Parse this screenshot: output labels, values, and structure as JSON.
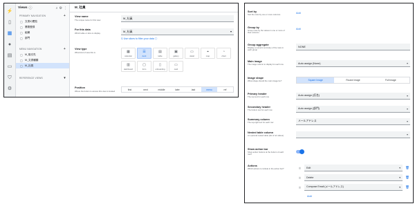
{
  "left": {
    "rail_icons": [
      "bolt-icon",
      "phone-icon",
      "grid-icon",
      "user-icon",
      "chart-icon",
      "chat-icon",
      "shield-icon",
      "gear-icon",
      "info-icon"
    ],
    "views_title": "Views",
    "primary_nav": "PRIMARY NAVIGATION",
    "primary_items": [
      "文書の閲覧",
      "業務登録",
      "組織",
      "部門"
    ],
    "menu_nav": "MENU NAVIGATION",
    "menu_items": [
      "M_取引先",
      "M_文書種類",
      "M_社員"
    ],
    "reference_views": "REFERENCE VIEWS",
    "main_title": "M_社員",
    "view_name_label": "View name",
    "view_name_help": "The unique name for this view.",
    "view_name_value": "M_社員",
    "for_data_label": "For this data",
    "for_data_help": "Which table or slice to display.",
    "for_data_value": "M_社員",
    "filter_link": "Use slices to filter your data",
    "view_type_label": "View type",
    "view_type_help": "What kind of view this is",
    "view_types": [
      "calendar",
      "deck",
      "table",
      "gallery",
      "detail",
      "map",
      "chart",
      "dashboard",
      "form",
      "onboarding",
      "card"
    ],
    "position_label": "Position",
    "position_help": "Where the button to access this view is located",
    "positions": [
      "first",
      "next",
      "middle",
      "later",
      "last",
      "menu",
      "ref"
    ],
    "position_selected": "menu"
  },
  "right": {
    "sort_by_label": "Sort by",
    "sort_by_help": "Sort the rows by one or more columns",
    "add": "Add",
    "group_by_label": "Group by",
    "group_by_help": "Group rows by the values in one or more of their columns",
    "group_agg_label": "Group aggregate",
    "group_agg_help": "Display a numeric summary of the rows in each group",
    "group_agg_value": "NONE",
    "main_image_label": "Main image",
    "main_image_help": "The image column to display for each row",
    "main_image_value": "Auto assign (None)",
    "image_shape_label": "Image shape",
    "image_shape_help": "What shape should the main image be?",
    "image_shapes": [
      "Square Image",
      "Round Image",
      "Full image"
    ],
    "primary_header_label": "Primary header",
    "primary_header_help": "The top text for each row",
    "primary_header_value": "Auto assign (氏名)",
    "secondary_header_label": "Secondary header",
    "secondary_header_help": "The bottom text for each row",
    "secondary_header_value": "Auto assign (部門)",
    "summary_col_label": "Summary column",
    "summary_col_help": "The top-right text for each row",
    "summary_col_value": "メールアドレス",
    "nested_label": "Nested table column",
    "nested_help": "An optional nested table (list of ref values)",
    "nested_value": "",
    "action_bar_label": "Show action bar",
    "action_bar_help": "Show action buttons at the bottom of each row?",
    "actions_label": "Actions",
    "actions_help": "Which actions to include in the action bar?",
    "actions": [
      "Edit",
      "Delete",
      "Compose Email (メールアドレス)"
    ]
  }
}
